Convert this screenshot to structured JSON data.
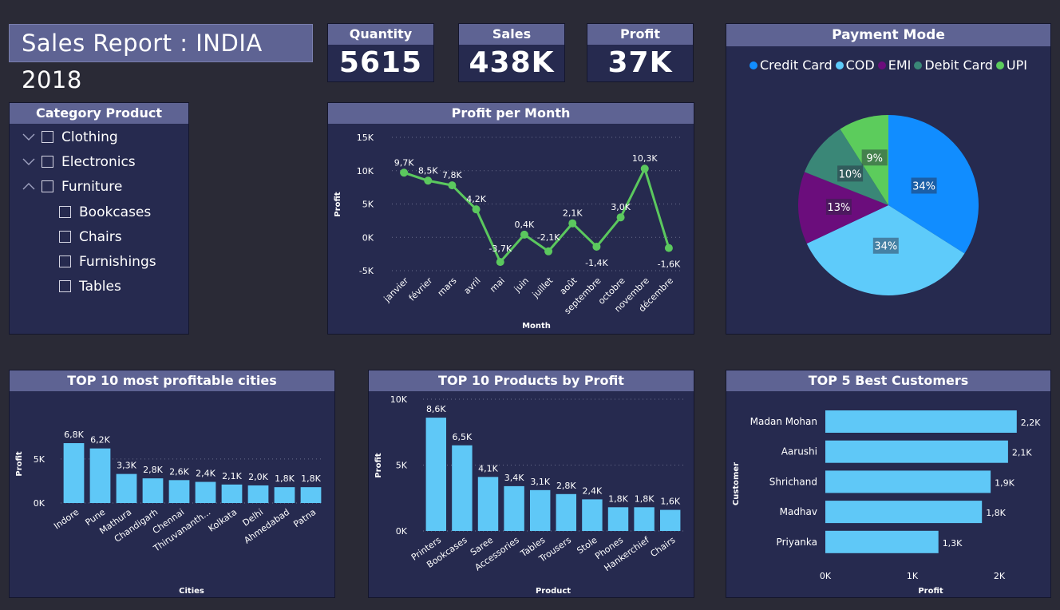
{
  "title": "Sales Report : INDIA 2018",
  "kpis": {
    "quantity": {
      "label": "Quantity",
      "value": "5615"
    },
    "sales": {
      "label": "Sales",
      "value": "438K"
    },
    "profit": {
      "label": "Profit",
      "value": "37K"
    }
  },
  "category_slicer": {
    "title": "Category Product",
    "items": [
      {
        "label": "Clothing",
        "expanded": false
      },
      {
        "label": "Electronics",
        "expanded": false
      },
      {
        "label": "Furniture",
        "expanded": true
      },
      {
        "label": "Bookcases",
        "child": true
      },
      {
        "label": "Chairs",
        "child": true
      },
      {
        "label": "Furnishings",
        "child": true
      },
      {
        "label": "Tables",
        "child": true
      }
    ]
  },
  "colors": {
    "bar": "#5fc8f7",
    "line": "#5bc85e",
    "credit_card": "#118dff",
    "cod": "#5ecbfa",
    "emi": "#6b0d7c",
    "debit_card": "#3a8777",
    "upi": "#5ccc5c"
  },
  "chart_data": [
    {
      "id": "profit_per_month",
      "type": "line",
      "title": "Profit per Month",
      "xlabel": "Month",
      "ylabel": "Profit",
      "yticks": [
        "-5K",
        "0K",
        "5K",
        "10K",
        "15K"
      ],
      "ylim": [
        -5000,
        15000
      ],
      "categories": [
        "janvier",
        "février",
        "mars",
        "avril",
        "mai",
        "juin",
        "juillet",
        "août",
        "septembre",
        "octobre",
        "novembre",
        "décembre"
      ],
      "values": [
        9700,
        8500,
        7800,
        4200,
        -3700,
        400,
        -2100,
        2100,
        -1400,
        3000,
        10300,
        -1600
      ],
      "labels": [
        "9,7K",
        "8,5K",
        "7,8K",
        "4,2K",
        "-3,7K",
        "0,4K",
        "-2,1K",
        "2,1K",
        "-1,4K",
        "3,0K",
        "10,3K",
        "-1,6K"
      ],
      "grid": true
    },
    {
      "id": "payment_mode",
      "type": "pie",
      "title": "Payment Mode",
      "legend": [
        "Credit Card",
        "COD",
        "EMI",
        "Debit Card",
        "UPI"
      ],
      "values": [
        34,
        34,
        13,
        10,
        9
      ],
      "labels": [
        "34%",
        "34%",
        "13%",
        "10%",
        "9%"
      ],
      "legend_position": "top"
    },
    {
      "id": "top_cities",
      "type": "bar",
      "title": "TOP 10 most profitable cities",
      "xlabel": "Cities",
      "ylabel": "Profit",
      "yticks": [
        "0K",
        "5K"
      ],
      "ylim": [
        0,
        7800
      ],
      "categories": [
        "Indore",
        "Pune",
        "Mathura",
        "Chandigarh",
        "Chennai",
        "Thiruvananth...",
        "Kolkata",
        "Delhi",
        "Ahmedabad",
        "Patna"
      ],
      "values": [
        6800,
        6200,
        3300,
        2800,
        2600,
        2400,
        2100,
        2000,
        1800,
        1800
      ],
      "labels": [
        "6,8K",
        "6,2K",
        "3,3K",
        "2,8K",
        "2,6K",
        "2,4K",
        "2,1K",
        "2,0K",
        "1,8K",
        "1,8K"
      ],
      "grid": true
    },
    {
      "id": "top_products",
      "type": "bar",
      "title": "TOP 10 Products by Profit",
      "xlabel": "Product",
      "ylabel": "Profit",
      "yticks": [
        "0K",
        "5K",
        "10K"
      ],
      "ylim": [
        0,
        10000
      ],
      "categories": [
        "Printers",
        "Bookcases",
        "Saree",
        "Accessories",
        "Tables",
        "Trousers",
        "Stole",
        "Phones",
        "Hankerchief",
        "Chairs"
      ],
      "values": [
        8600,
        6500,
        4100,
        3400,
        3100,
        2800,
        2400,
        1800,
        1800,
        1600
      ],
      "labels": [
        "8,6K",
        "6,5K",
        "4,1K",
        "3,4K",
        "3,1K",
        "2,8K",
        "2,4K",
        "1,8K",
        "1,8K",
        "1,6K"
      ],
      "grid": true
    },
    {
      "id": "top_customers",
      "type": "bar",
      "orientation": "horizontal",
      "title": "TOP 5 Best Customers",
      "xlabel": "Profit",
      "ylabel": "Customer",
      "xticks": [
        "0K",
        "1K",
        "2K"
      ],
      "xlim": [
        0,
        2000
      ],
      "categories": [
        "Madan Mohan",
        "Aarushi",
        "Shrichand",
        "Madhav",
        "Priyanka"
      ],
      "values": [
        2200,
        2100,
        1900,
        1800,
        1300
      ],
      "labels": [
        "2,2K",
        "2,1K",
        "1,9K",
        "1,8K",
        "1,3K"
      ]
    }
  ]
}
